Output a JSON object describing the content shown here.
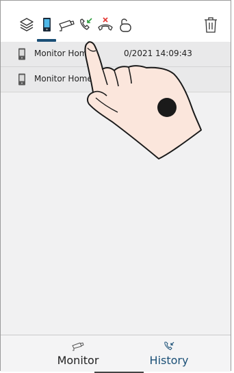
{
  "toolbar": {
    "icons": [
      "layers-icon",
      "indoor-monitor-icon",
      "camera-icon",
      "answered-call-icon",
      "missed-call-icon",
      "unlock-icon",
      "trash-icon"
    ],
    "active_tab": "indoor-monitor-icon",
    "accent": "#1a4f76",
    "missed_color": "#e53935",
    "answered_color": "#2e9e3e"
  },
  "history_list": [
    {
      "name": "Monitor Home",
      "timestamp": "0/2021 14:09:43"
    },
    {
      "name": "Monitor Home",
      "timestamp": ""
    }
  ],
  "step_marker": "❸",
  "bottom_nav": {
    "monitor_label": "Monitor",
    "history_label": "History"
  }
}
